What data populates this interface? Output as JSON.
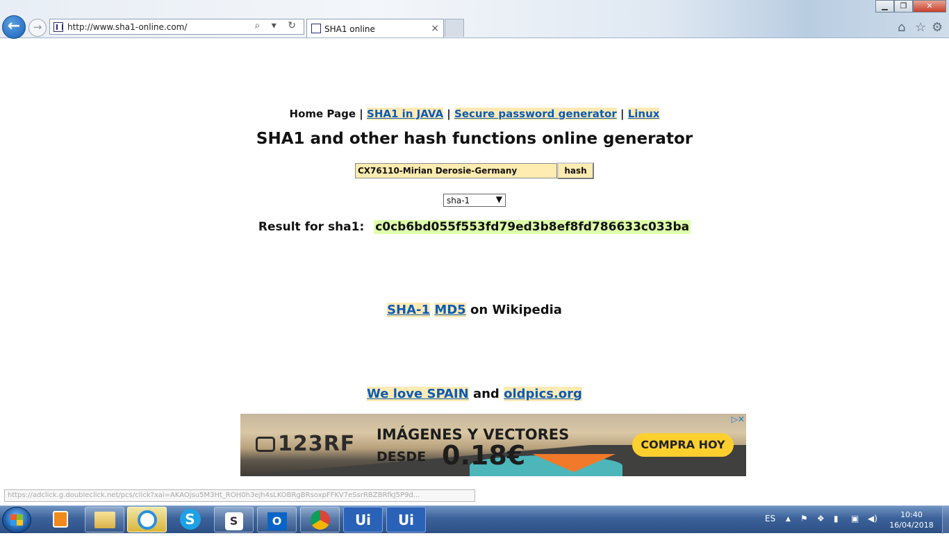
{
  "browser": {
    "url_host": "http://www.sha1-online.com/",
    "url_faded": "",
    "tab_title": "SHA1 online",
    "tab_close": "×",
    "addr_tools": "⌕ ▾ ↻",
    "win_min": "▁",
    "win_max": "❐",
    "win_close": "✕",
    "back_glyph": "←",
    "fwd_glyph": "→",
    "home_glyph": "⌂",
    "fav_glyph": "☆",
    "settings_glyph": "⚙"
  },
  "nav": {
    "home": "Home Page",
    "sep": "|",
    "links": [
      "SHA1 in JAVA",
      "Secure password generator",
      "Linux"
    ]
  },
  "page": {
    "heading": "SHA1 and other hash functions online generator",
    "input_value": "CX76110-Mirian Derosie-Germany",
    "hash_button": "hash",
    "algorithm": "sha-1",
    "algorithm_caret": "▼",
    "result_label": "Result for sha1:",
    "result_hash": "c0cb6bd055f553fd79ed3b8ef8fd786633c033ba",
    "wiki_links": [
      "SHA-1",
      "MD5"
    ],
    "wiki_suffix": "on Wikipedia",
    "love_link": "We love SPAIN",
    "love_and": "and",
    "love_link2": "oldpics.org"
  },
  "ad": {
    "logo": "123RF",
    "line1": "IMÁGENES Y VECTORES",
    "desde": "DESDE",
    "price": "0.18€",
    "cta": "COMPRA HOY",
    "adchoices": "▷✕"
  },
  "status_url": "https://adclick.g.doubleclick.net/pcs/click?xai=AKAOjsu5M3Ht_ROH0h3ejh4sLKOBRgBRsoxpFFKV7eSsrRBZBRfkJ5P9d...",
  "taskbar": {
    "apps": [
      "",
      "",
      "",
      "S",
      "S",
      "O",
      "",
      "Ui",
      "Ui"
    ],
    "lang": "ES",
    "time": "10:40",
    "date": "16/04/2018",
    "tray_up": "▲"
  },
  "colors": {
    "link": "#0b5bb5",
    "link_bg": "#ffeab4",
    "hash_bg": "#deffaa",
    "input_bg": "#ffecb0"
  }
}
